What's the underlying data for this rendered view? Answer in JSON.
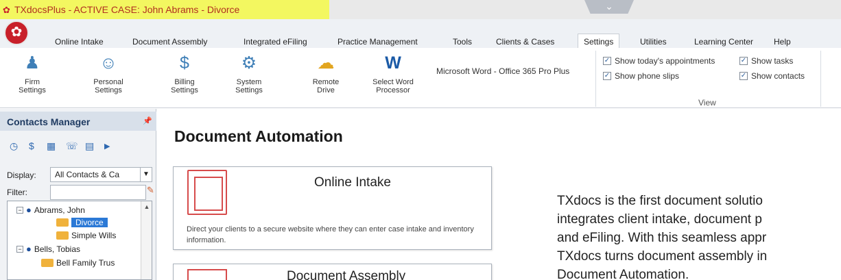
{
  "window": {
    "title": "TXdocsPlus - ACTIVE CASE: John Abrams - Divorce",
    "highlight_color": "#f3f760",
    "logo_icon": "txdocs-logo-icon"
  },
  "menu": {
    "tabs": [
      {
        "label": "Online Intake"
      },
      {
        "label": "Document Assembly"
      },
      {
        "label": "Integrated eFiling"
      },
      {
        "label": "Practice Management"
      },
      {
        "label": "Tools"
      },
      {
        "label": "Clients & Cases"
      },
      {
        "label": "Settings",
        "active": true
      },
      {
        "label": "Utilities"
      },
      {
        "label": "Learning Center"
      },
      {
        "label": "Help"
      }
    ]
  },
  "ribbon": {
    "buttons": [
      {
        "label": "Firm\nSettings",
        "icon": "firm-settings-icon"
      },
      {
        "label": "Personal\nSettings",
        "icon": "personal-settings-icon"
      },
      {
        "label": "Billing\nSettings",
        "icon": "billing-settings-icon"
      },
      {
        "label": "System\nSettings",
        "icon": "system-settings-icon"
      },
      {
        "label": "Remote\nDrive",
        "icon": "remote-drive-icon"
      },
      {
        "label": "Select Word\nProcessor",
        "icon": "word-icon"
      }
    ],
    "word_version": "Microsoft Word - Office 365 Pro Plus",
    "view_group": {
      "label": "View",
      "checkboxes": [
        {
          "label": "Show today's appointments",
          "checked": true
        },
        {
          "label": "Show tasks",
          "checked": true
        },
        {
          "label": "Show phone slips",
          "checked": true
        },
        {
          "label": "Show contacts",
          "checked": true
        }
      ]
    }
  },
  "contacts": {
    "title": "Contacts Manager",
    "pin_icon": "pin-icon",
    "display_label": "Display:",
    "display_value": "All Contacts & Ca",
    "filter_label": "Filter:",
    "filter_value": "",
    "tree": [
      {
        "label": "Abrams, John",
        "type": "person",
        "expanded": true
      },
      {
        "label": "Divorce",
        "type": "case",
        "selected": true
      },
      {
        "label": "Simple Wills",
        "type": "case"
      },
      {
        "label": "Bells, Tobias",
        "type": "person",
        "expanded": true
      },
      {
        "label": "Bell Family Trus",
        "type": "case"
      }
    ]
  },
  "main": {
    "title": "Document Automation",
    "cards": [
      {
        "title": "Online Intake",
        "description": "Direct your clients to a secure website where they can enter case intake and inventory information."
      },
      {
        "title": "Document Assembly"
      }
    ],
    "description_lines": [
      "TXdocs is the first document solutio",
      "integrates client intake, document p",
      "and eFiling. With this seamless appr",
      "TXdocs turns document assembly in",
      "Document Automation."
    ]
  }
}
